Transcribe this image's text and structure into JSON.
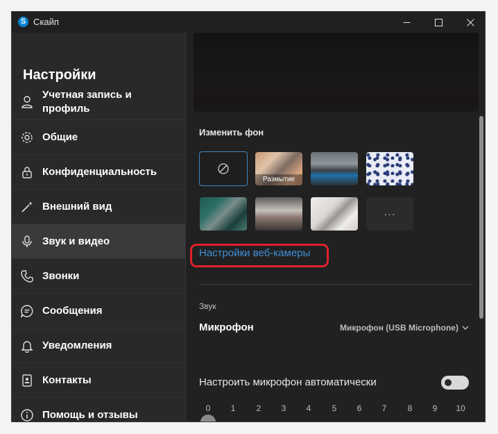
{
  "window": {
    "title": "Скайп",
    "logo_letter": "S"
  },
  "sidebar": {
    "title": "Настройки",
    "items": [
      {
        "label": "Учетная запись и профиль",
        "icon": "person-icon"
      },
      {
        "label": "Общие",
        "icon": "gear-icon"
      },
      {
        "label": "Конфиденциальность",
        "icon": "lock-icon"
      },
      {
        "label": "Внешний вид",
        "icon": "magic-wand-icon"
      },
      {
        "label": "Звук и видео",
        "icon": "microphone-icon",
        "active": true
      },
      {
        "label": "Звонки",
        "icon": "phone-icon"
      },
      {
        "label": "Сообщения",
        "icon": "chat-bubble-icon"
      },
      {
        "label": "Уведомления",
        "icon": "bell-icon"
      },
      {
        "label": "Контакты",
        "icon": "contact-card-icon"
      },
      {
        "label": "Помощь и отзывы",
        "icon": "info-icon"
      }
    ]
  },
  "content": {
    "change_background_label": "Изменить фон",
    "backgrounds": [
      {
        "name": "none",
        "selected": true
      },
      {
        "name": "blur",
        "label": "Размытие"
      },
      {
        "name": "lake"
      },
      {
        "name": "pattern"
      },
      {
        "name": "office"
      },
      {
        "name": "workshop"
      },
      {
        "name": "room"
      },
      {
        "name": "more",
        "label": "···"
      }
    ],
    "webcam_settings_link": "Настройки веб-камеры",
    "sound_section_label": "Звук",
    "microphone_label": "Микрофон",
    "microphone_device": "Микрофон (USB Microphone)",
    "auto_mic_label": "Настроить микрофон автоматически",
    "auto_mic_enabled": false,
    "mic_level_scale": [
      "0",
      "1",
      "2",
      "3",
      "4",
      "5",
      "6",
      "7",
      "8",
      "9",
      "10"
    ],
    "mic_level_value": 0
  },
  "colors": {
    "accent_link": "#3f8fd8",
    "highlight_box": "#e0212a",
    "selected_tile_border": "#3e86c6",
    "skype_blue": "#0a84d6"
  }
}
